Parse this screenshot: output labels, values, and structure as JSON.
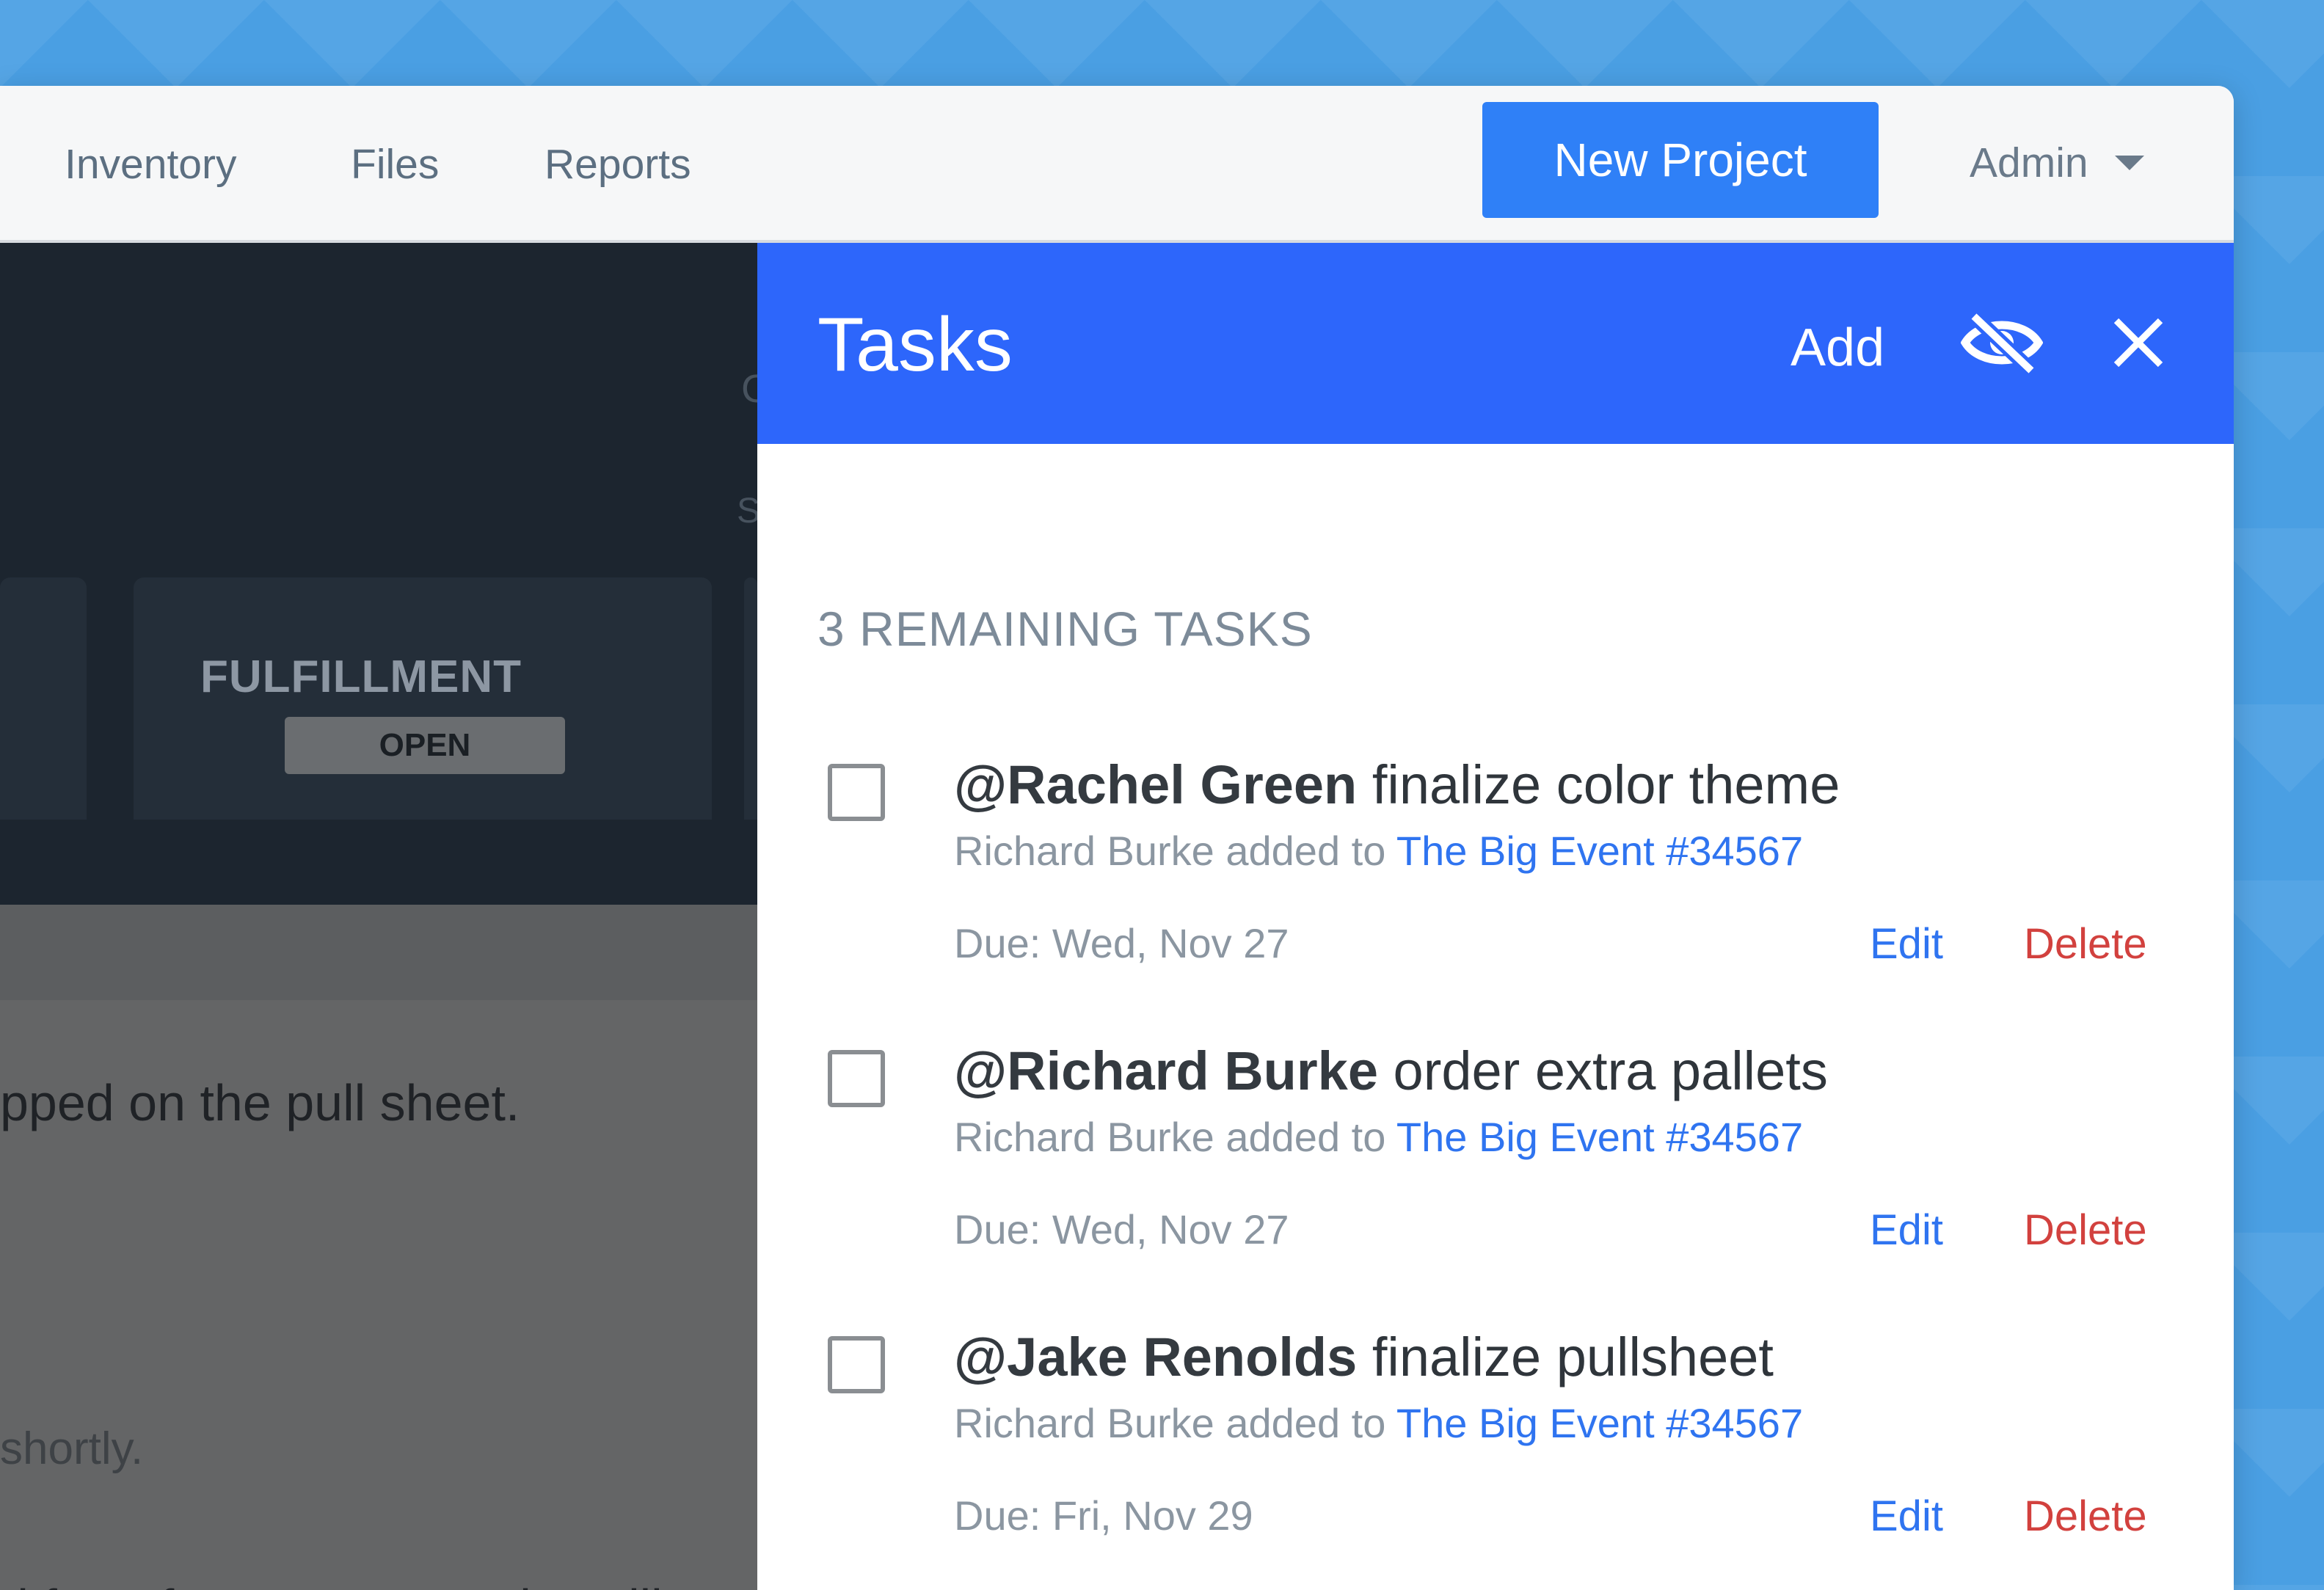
{
  "nav": {
    "items": [
      {
        "label": "Inventory"
      },
      {
        "label": "Files"
      },
      {
        "label": "Reports"
      }
    ],
    "new_project_label": "New Project",
    "user_label": "Admin"
  },
  "background": {
    "stage_title": "FULFILLMENT",
    "stage_status": "OPEN",
    "peek_letters": [
      "C",
      "S"
    ],
    "text_lines": [
      "pped on the pull sheet.",
      "shortly.",
      "d for a future auto-pay installi"
    ]
  },
  "tasks_panel": {
    "title": "Tasks",
    "add_label": "Add",
    "hide_icon": "eye-slash-icon",
    "close_icon": "close-icon",
    "remaining_label": "3 REMAINING TASKS",
    "tasks": [
      {
        "assignee": "@Rachel Green",
        "action": " finalize color theme",
        "meta_prefix": "Richard Burke added to ",
        "project": "The Big Event #34567",
        "due": "Due: Wed, Nov 27",
        "edit_label": "Edit",
        "delete_label": "Delete"
      },
      {
        "assignee": "@Richard Burke",
        "action": " order extra pallets",
        "meta_prefix": "Richard Burke added to ",
        "project": "The Big Event #34567",
        "due": "Due: Wed, Nov 27",
        "edit_label": "Edit",
        "delete_label": "Delete"
      },
      {
        "assignee": "@Jake Renolds",
        "action": " finalize pullsheet",
        "meta_prefix": "Richard Burke added to ",
        "project": "The Big Event #34567",
        "due": "Due: Fri, Nov 29",
        "edit_label": "Edit",
        "delete_label": "Delete"
      }
    ]
  },
  "colors": {
    "accent": "#2f80f7",
    "panel_header": "#2d66fb",
    "delete": "#d2413e",
    "link": "#2f74f0"
  }
}
